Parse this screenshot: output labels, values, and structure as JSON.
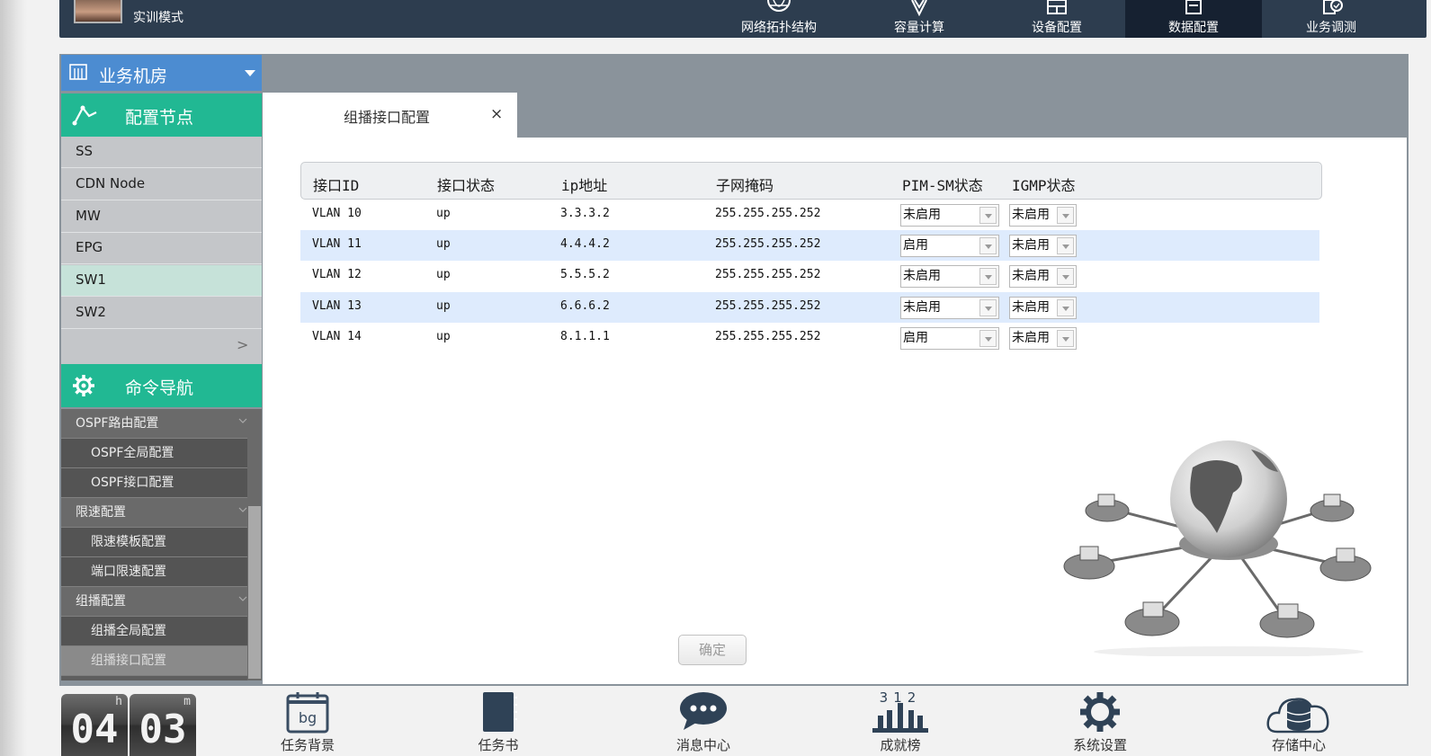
{
  "header": {
    "mode_label": "实训模式",
    "nav": [
      {
        "label": "网络拓扑结构",
        "icon": "globe-icon"
      },
      {
        "label": "容量计算",
        "icon": "antenna-icon"
      },
      {
        "label": "设备配置",
        "icon": "rack-icon"
      },
      {
        "label": "数据配置",
        "icon": "monitor-icon",
        "active": true
      },
      {
        "label": "业务调测",
        "icon": "check-document-icon"
      }
    ]
  },
  "sidebar": {
    "room_select": {
      "icon": "building-icon",
      "label": "业务机房"
    },
    "nodes_section": {
      "icon": "nodes-icon",
      "label": "配置节点"
    },
    "nodes": [
      "SS",
      "CDN Node",
      "MW",
      "EPG",
      "SW1",
      "SW2"
    ],
    "active_node": "SW1",
    "nodes_more": ">",
    "commands_section": {
      "icon": "gear-icon",
      "label": "命令导航"
    },
    "commands": [
      {
        "label": "OSPF路由配置",
        "type": "group"
      },
      {
        "label": "OSPF全局配置",
        "type": "sub"
      },
      {
        "label": "OSPF接口配置",
        "type": "sub"
      },
      {
        "label": "限速配置",
        "type": "group"
      },
      {
        "label": "限速模板配置",
        "type": "sub"
      },
      {
        "label": "端口限速配置",
        "type": "sub"
      },
      {
        "label": "组播配置",
        "type": "group"
      },
      {
        "label": "组播全局配置",
        "type": "sub"
      },
      {
        "label": "组播接口配置",
        "type": "sub",
        "active": true
      }
    ]
  },
  "tab": {
    "title": "组播接口配置",
    "close": "×"
  },
  "table": {
    "headers": [
      "接口ID",
      "接口状态",
      "ip地址",
      "子网掩码",
      "PIM-SM状态",
      "IGMP状态"
    ],
    "rows": [
      {
        "id": "VLAN 10",
        "status": "up",
        "ip": "3.3.3.2",
        "mask": "255.255.255.252",
        "pim": "未启用",
        "igmp": "未启用"
      },
      {
        "id": "VLAN 11",
        "status": "up",
        "ip": "4.4.4.2",
        "mask": "255.255.255.252",
        "pim": "启用",
        "igmp": "未启用"
      },
      {
        "id": "VLAN 12",
        "status": "up",
        "ip": "5.5.5.2",
        "mask": "255.255.255.252",
        "pim": "未启用",
        "igmp": "未启用"
      },
      {
        "id": "VLAN 13",
        "status": "up",
        "ip": "6.6.6.2",
        "mask": "255.255.255.252",
        "pim": "未启用",
        "igmp": "未启用"
      },
      {
        "id": "VLAN 14",
        "status": "up",
        "ip": "8.1.1.1",
        "mask": "255.255.255.252",
        "pim": "启用",
        "igmp": "未启用"
      }
    ]
  },
  "confirm_label": "确定",
  "clock": {
    "hours": "04",
    "minutes": "03",
    "hour_unit": "h",
    "minute_unit": "m"
  },
  "dock": [
    {
      "label": "任务背景",
      "icon": "calendar-icon",
      "icon_text": "bg"
    },
    {
      "label": "任务书",
      "icon": "notebook-icon"
    },
    {
      "label": "消息中心",
      "icon": "chat-bubble-icon"
    },
    {
      "label": "成就榜",
      "icon": "podium-icon",
      "icon_text": "312"
    },
    {
      "label": "系统设置",
      "icon": "gear-icon"
    },
    {
      "label": "存储中心",
      "icon": "cloud-database-icon"
    }
  ]
}
